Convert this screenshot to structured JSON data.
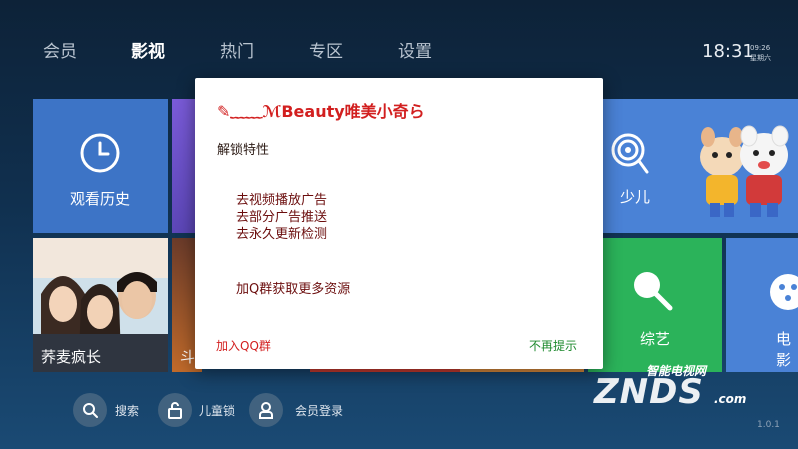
{
  "nav": {
    "tabs": [
      {
        "label": "会员"
      },
      {
        "label": "影视"
      },
      {
        "label": "热门"
      },
      {
        "label": "专区"
      },
      {
        "label": "设置"
      }
    ],
    "active_index": 1
  },
  "status": {
    "time": "18:31",
    "small_time": "09:26",
    "weekday": "星期六"
  },
  "tiles": {
    "history": "观看历史",
    "featured_1": "荞麦疯长",
    "featured_2": "斗",
    "kids": "少儿",
    "variety": "综艺",
    "tv": "电影"
  },
  "bottom": {
    "search": "搜索",
    "child_lock": "儿童锁",
    "login": "会员登录"
  },
  "dialog": {
    "title": "✎﹏﹏ℳBeauty唯美小奇ら",
    "subtitle": "解锁特性",
    "features": [
      "去视频播放广告",
      "去部分广告推送",
      "去永久更新检测"
    ],
    "extra": "加Q群获取更多资源",
    "join_button": "加入QQ群",
    "dismiss_button": "不再提示"
  },
  "watermark": {
    "text_top": "智能电视网",
    "text_main": "ZNDS",
    "text_suffix": ".com"
  },
  "version": "1.0.1",
  "colors": {
    "accent_red": "#d21f1f",
    "accent_green": "#1e8a2e",
    "tile_blue": "#3d74c6",
    "tile_purple": "#6b4fc7",
    "tile_green": "#2bb35a",
    "tile_light_blue": "#4a82d6"
  }
}
